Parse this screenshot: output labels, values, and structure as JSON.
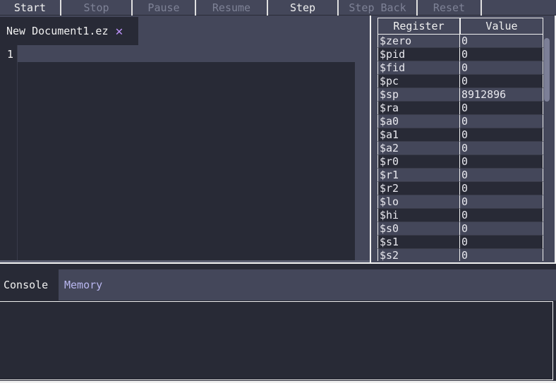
{
  "toolbar": {
    "buttons": [
      {
        "label": "Start",
        "enabled": true
      },
      {
        "label": "Stop",
        "enabled": false
      },
      {
        "label": "Pause",
        "enabled": false
      },
      {
        "label": "Resume",
        "enabled": false
      },
      {
        "label": "Step",
        "enabled": true
      },
      {
        "label": "Step Back",
        "enabled": false
      },
      {
        "label": "Reset",
        "enabled": false
      }
    ]
  },
  "editor": {
    "tab_title": "New Document1.ez",
    "close_glyph": "✕",
    "line_number": "1"
  },
  "registers": {
    "header_register": "Register",
    "header_value": "Value",
    "rows": [
      {
        "name": "$zero",
        "value": "0"
      },
      {
        "name": "$pid",
        "value": "0"
      },
      {
        "name": "$fid",
        "value": "0"
      },
      {
        "name": "$pc",
        "value": "0"
      },
      {
        "name": "$sp",
        "value": "8912896"
      },
      {
        "name": "$ra",
        "value": "0"
      },
      {
        "name": "$a0",
        "value": "0"
      },
      {
        "name": "$a1",
        "value": "0"
      },
      {
        "name": "$a2",
        "value": "0"
      },
      {
        "name": "$r0",
        "value": "0"
      },
      {
        "name": "$r1",
        "value": "0"
      },
      {
        "name": "$r2",
        "value": "0"
      },
      {
        "name": "$lo",
        "value": "0"
      },
      {
        "name": "$hi",
        "value": "0"
      },
      {
        "name": "$s0",
        "value": "0"
      },
      {
        "name": "$s1",
        "value": "0"
      },
      {
        "name": "$s2",
        "value": "0"
      }
    ]
  },
  "bottom_panel": {
    "tabs": [
      "Console",
      "Memory"
    ],
    "active_tab": "Console"
  },
  "colors": {
    "background_dark": "#282a36",
    "panel": "#44475a",
    "accent": "#bd93f9",
    "disabled_text": "#7e8296"
  }
}
